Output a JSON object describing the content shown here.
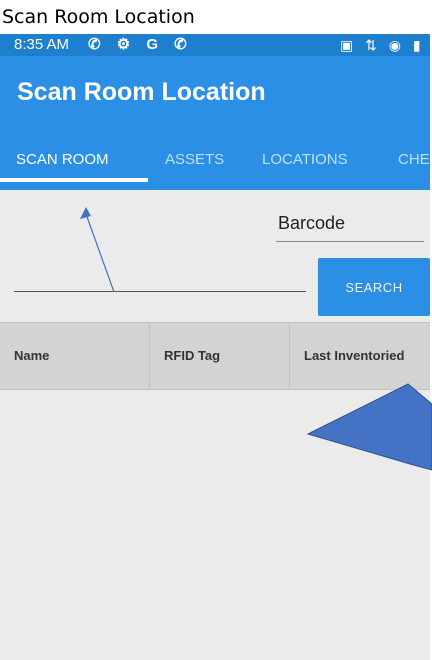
{
  "caption": "Scan Room Location",
  "status_bar": {
    "time": "8:35 AM",
    "left_icons": "✆ ⚙ G ✆",
    "right_icons": "▣ ⇅ ◉ ▮"
  },
  "app_bar": {
    "title": "Scan Room Location"
  },
  "tabs": [
    {
      "label": "SCAN ROOM"
    },
    {
      "label": "ASSETS"
    },
    {
      "label": "LOCATIONS"
    },
    {
      "label": "CHE"
    }
  ],
  "form": {
    "barcode_selected": "Barcode",
    "scan_input_value": "",
    "search_label": "SEARCH"
  },
  "table": {
    "columns": [
      "Name",
      "RFID Tag",
      "Last Inventoried"
    ]
  },
  "colors": {
    "status_bar": "#1e7fcf",
    "app_bar": "#2b8fe6",
    "annotation_arrow": "#4472c4"
  }
}
